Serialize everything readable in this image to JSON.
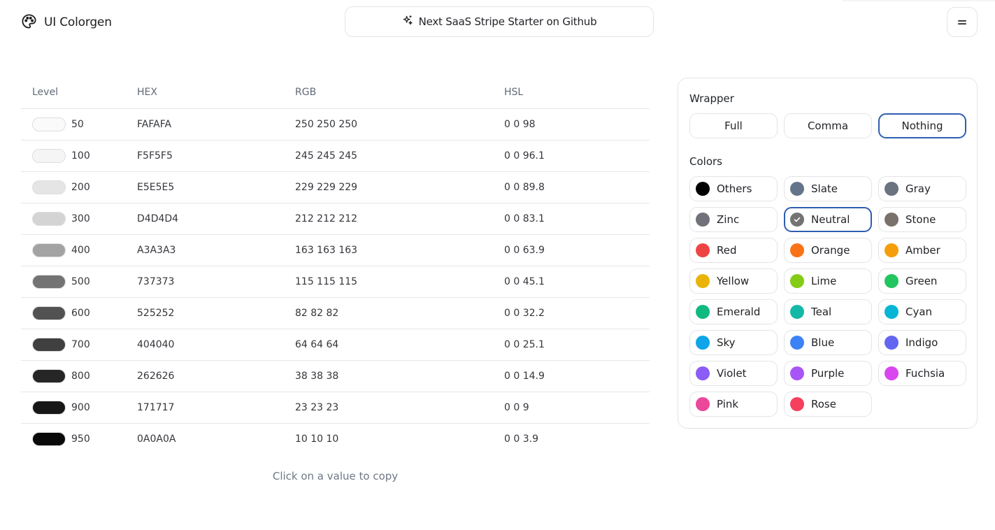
{
  "brand": {
    "name": "UI Colorgen"
  },
  "header": {
    "github_button": "Next SaaS Stripe Starter on Github"
  },
  "table": {
    "columns": [
      "Level",
      "HEX",
      "RGB",
      "HSL"
    ],
    "rows": [
      {
        "level": "50",
        "hex": "FAFAFA",
        "rgb": "250 250 250",
        "hsl": "0 0 98",
        "color": "#FAFAFA"
      },
      {
        "level": "100",
        "hex": "F5F5F5",
        "rgb": "245 245 245",
        "hsl": "0 0 96.1",
        "color": "#F5F5F5"
      },
      {
        "level": "200",
        "hex": "E5E5E5",
        "rgb": "229 229 229",
        "hsl": "0 0 89.8",
        "color": "#E5E5E5"
      },
      {
        "level": "300",
        "hex": "D4D4D4",
        "rgb": "212 212 212",
        "hsl": "0 0 83.1",
        "color": "#D4D4D4"
      },
      {
        "level": "400",
        "hex": "A3A3A3",
        "rgb": "163 163 163",
        "hsl": "0 0 63.9",
        "color": "#A3A3A3"
      },
      {
        "level": "500",
        "hex": "737373",
        "rgb": "115 115 115",
        "hsl": "0 0 45.1",
        "color": "#737373"
      },
      {
        "level": "600",
        "hex": "525252",
        "rgb": "82 82 82",
        "hsl": "0 0 32.2",
        "color": "#525252"
      },
      {
        "level": "700",
        "hex": "404040",
        "rgb": "64 64 64",
        "hsl": "0 0 25.1",
        "color": "#404040"
      },
      {
        "level": "800",
        "hex": "262626",
        "rgb": "38 38 38",
        "hsl": "0 0 14.9",
        "color": "#262626"
      },
      {
        "level": "900",
        "hex": "171717",
        "rgb": "23 23 23",
        "hsl": "0 0 9",
        "color": "#171717"
      },
      {
        "level": "950",
        "hex": "0A0A0A",
        "rgb": "10 10 10",
        "hsl": "0 0 3.9",
        "color": "#0A0A0A"
      }
    ],
    "hint": "Click on a value to copy"
  },
  "panel": {
    "wrapper_title": "Wrapper",
    "wrapper_options": [
      {
        "label": "Full",
        "active": false
      },
      {
        "label": "Comma",
        "active": false
      },
      {
        "label": "Nothing",
        "active": true
      }
    ],
    "colors_title": "Colors",
    "colors": [
      {
        "name": "Others",
        "swatch": "#000000",
        "active": false
      },
      {
        "name": "Slate",
        "swatch": "#64748B",
        "active": false
      },
      {
        "name": "Gray",
        "swatch": "#6B7280",
        "active": false
      },
      {
        "name": "Zinc",
        "swatch": "#71717A",
        "active": false
      },
      {
        "name": "Neutral",
        "swatch": "#737373",
        "active": true
      },
      {
        "name": "Stone",
        "swatch": "#78716C",
        "active": false
      },
      {
        "name": "Red",
        "swatch": "#EF4444",
        "active": false
      },
      {
        "name": "Orange",
        "swatch": "#F97316",
        "active": false
      },
      {
        "name": "Amber",
        "swatch": "#F59E0B",
        "active": false
      },
      {
        "name": "Yellow",
        "swatch": "#EAB308",
        "active": false
      },
      {
        "name": "Lime",
        "swatch": "#84CC16",
        "active": false
      },
      {
        "name": "Green",
        "swatch": "#22C55E",
        "active": false
      },
      {
        "name": "Emerald",
        "swatch": "#10B981",
        "active": false
      },
      {
        "name": "Teal",
        "swatch": "#14B8A6",
        "active": false
      },
      {
        "name": "Cyan",
        "swatch": "#06B6D4",
        "active": false
      },
      {
        "name": "Sky",
        "swatch": "#0EA5E9",
        "active": false
      },
      {
        "name": "Blue",
        "swatch": "#3B82F6",
        "active": false
      },
      {
        "name": "Indigo",
        "swatch": "#6366F1",
        "active": false
      },
      {
        "name": "Violet",
        "swatch": "#8B5CF6",
        "active": false
      },
      {
        "name": "Purple",
        "swatch": "#A855F7",
        "active": false
      },
      {
        "name": "Fuchsia",
        "swatch": "#D946EF",
        "active": false
      },
      {
        "name": "Pink",
        "swatch": "#EC4899",
        "active": false
      },
      {
        "name": "Rose",
        "swatch": "#F43F5E",
        "active": false
      }
    ]
  },
  "icons": {
    "brand": "palette-icon",
    "github_button": "sparkles-icon",
    "menu": "menu-icon",
    "selected": "check-icon"
  },
  "theme": {
    "accent_border": "#2E5DB0",
    "border": "#E3E4E7",
    "muted_text": "#6F7885"
  }
}
